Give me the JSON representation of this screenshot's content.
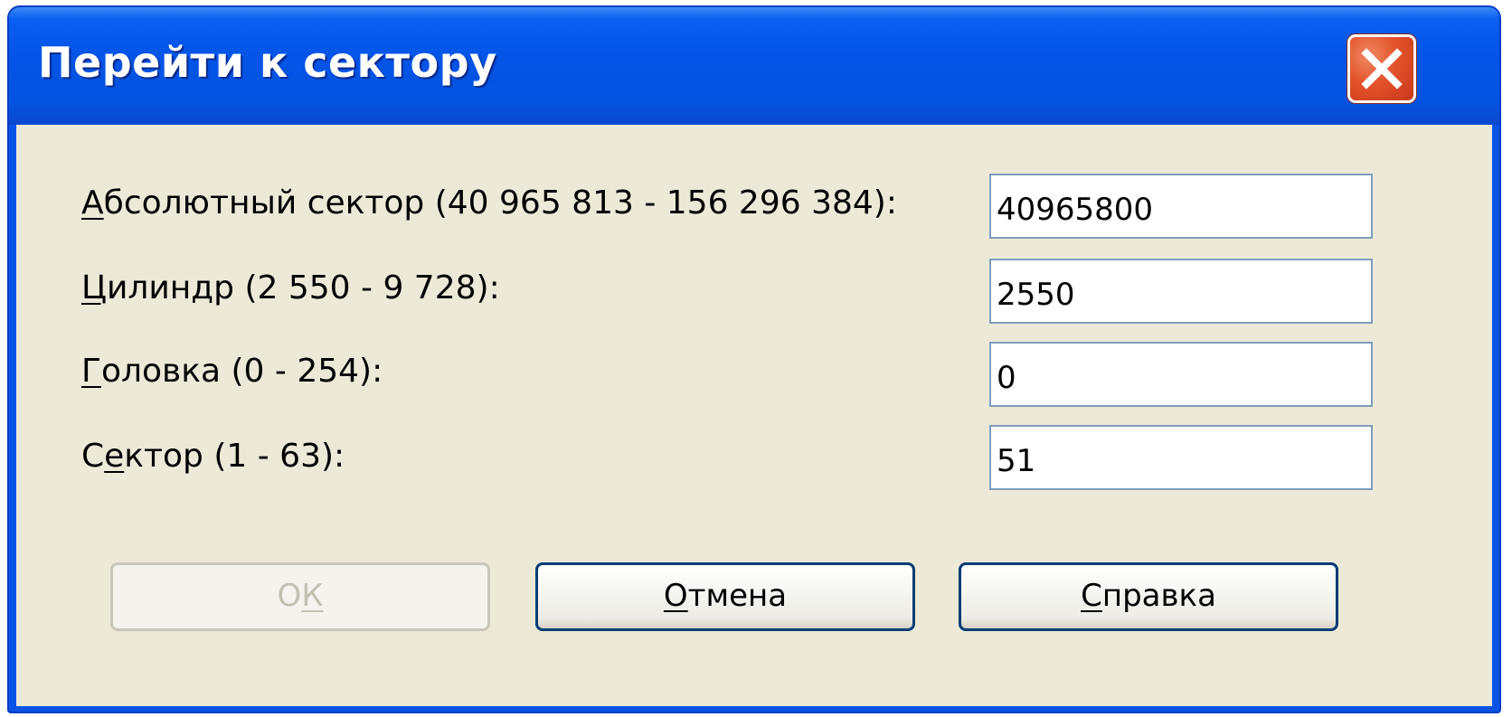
{
  "window": {
    "title": "Перейти к сектору"
  },
  "fields": [
    {
      "label_mnemonic": "А",
      "label_rest": "бсолютный сектор (40 965 813 - 156 296 384):",
      "value": "40965800"
    },
    {
      "label_mnemonic": "Ц",
      "label_rest": "илиндр (2 550 - 9 728):",
      "value": "2550"
    },
    {
      "label_mnemonic": "Г",
      "label_rest": "оловка (0 - 254):",
      "value": "0"
    },
    {
      "label_pre": "С",
      "label_mnemonic": "е",
      "label_rest": "ктор (1 - 63):",
      "value": "51"
    }
  ],
  "buttons": {
    "ok": {
      "pre": "О",
      "mnemonic": "К",
      "disabled": true
    },
    "cancel": {
      "mnemonic": "О",
      "rest": "тмена"
    },
    "help": {
      "mnemonic": "С",
      "rest": "правка"
    }
  },
  "colors": {
    "titlebar": "#0454e6",
    "client": "#ece9d8",
    "close_button": "#e2522b",
    "button_border": "#003c74"
  },
  "icons": {
    "close": "close-x-icon"
  }
}
